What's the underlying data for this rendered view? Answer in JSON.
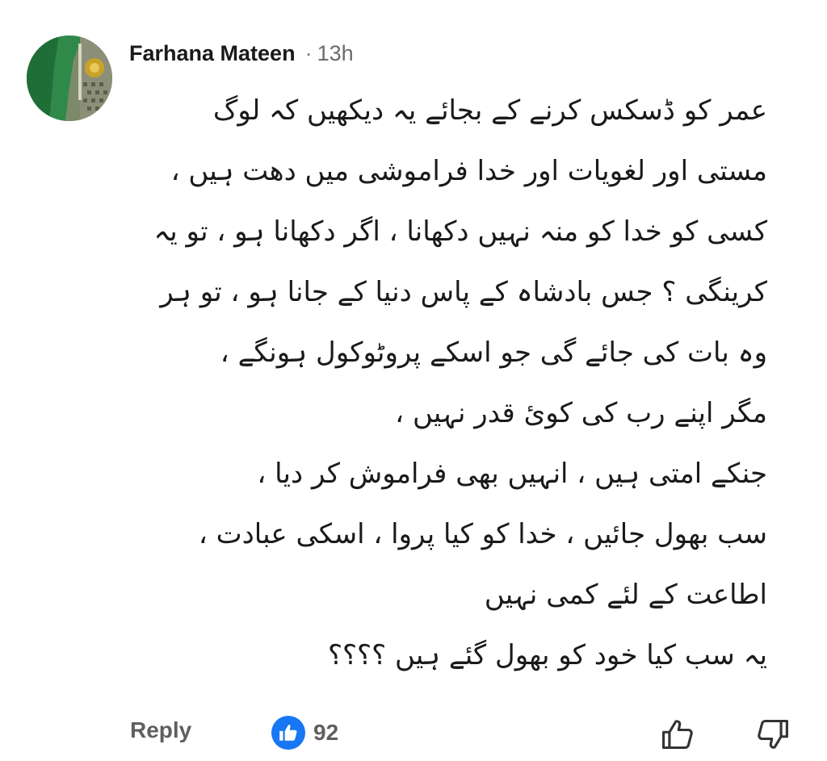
{
  "comment": {
    "author": "Farhana Mateen",
    "separator": "·",
    "time": "13h",
    "avatar_icon": "profile-photo",
    "lines": [
      "عمر کو ڈسکس کرنے کے بجائے یہ دیکھیں کہ لوگ",
      "مستی اور لغویات اور خدا فراموشی میں دھت ہیں ،",
      "کسی کو خدا کو منہ نہیں دکھانا ، اگر دکھانا ہو ، تو یہ",
      "کرینگی ؟ جس بادشاہ کے پاس دنیا کے جانا ہو ، تو ہر",
      "وہ بات کی جائے گی جو اسکے پروٹوکول ہونگے ،",
      "مگر اپنے رب کی کوئ قدر نہیں ،",
      "جنکے امتی ہیں ، انہیں بھی فراموش کر دیا ،",
      "سب بھول جائیں ، خدا کو کیا پروا ، اسکی عبادت ،",
      "اطاعت کے لئے کمی نہیں",
      "یہ سب کیا خود کو بھول گئے ہیں ؟؟؟؟"
    ]
  },
  "actions": {
    "reply_label": "Reply",
    "like_count": "92",
    "like_badge_color": "#1877f2",
    "thumb_up_icon": "thumbs-up-outline",
    "thumb_down_icon": "thumbs-down-outline"
  }
}
